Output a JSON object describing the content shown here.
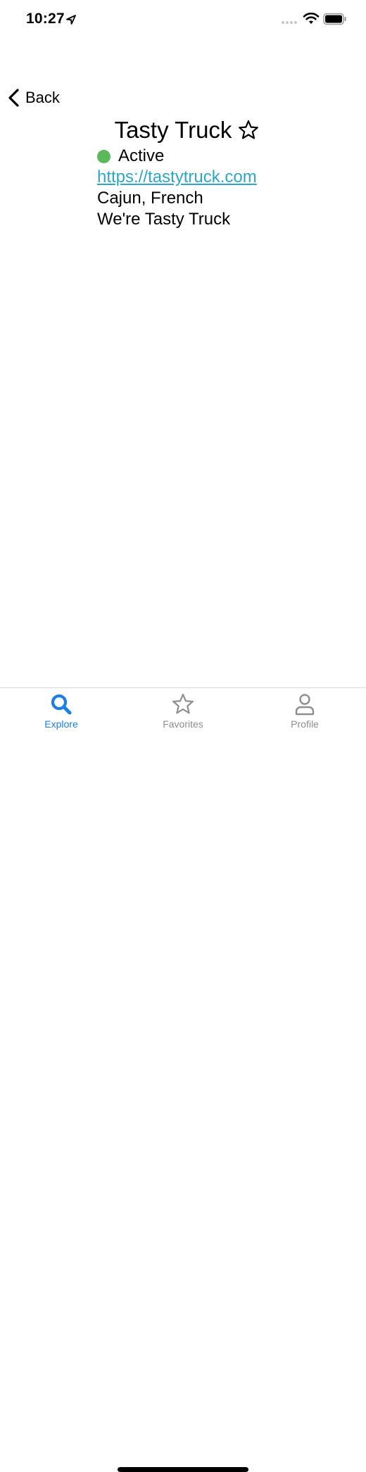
{
  "status_bar": {
    "time": "10:27",
    "icons": [
      "location-arrow-icon",
      "signal-dots-icon",
      "wifi-icon",
      "battery-icon"
    ]
  },
  "nav": {
    "back_label": "Back",
    "back_icon": "chevron-left-icon"
  },
  "truck": {
    "name": "Tasty Truck",
    "favorite_icon": "star-outline-icon",
    "status": "Active",
    "status_color": "#5cb85c",
    "website": "https://tastytruck.com",
    "link_color": "#2ba8c8",
    "cuisines": "Cajun, French",
    "description": "We're Tasty Truck"
  },
  "tabs": [
    {
      "label": "Explore",
      "icon": "search-icon",
      "selected": true,
      "color": "#1a7fe6"
    },
    {
      "label": "Favorites",
      "icon": "star-icon",
      "selected": false,
      "color": "#8e8e93"
    },
    {
      "label": "Profile",
      "icon": "person-icon",
      "selected": false,
      "color": "#8e8e93"
    }
  ]
}
